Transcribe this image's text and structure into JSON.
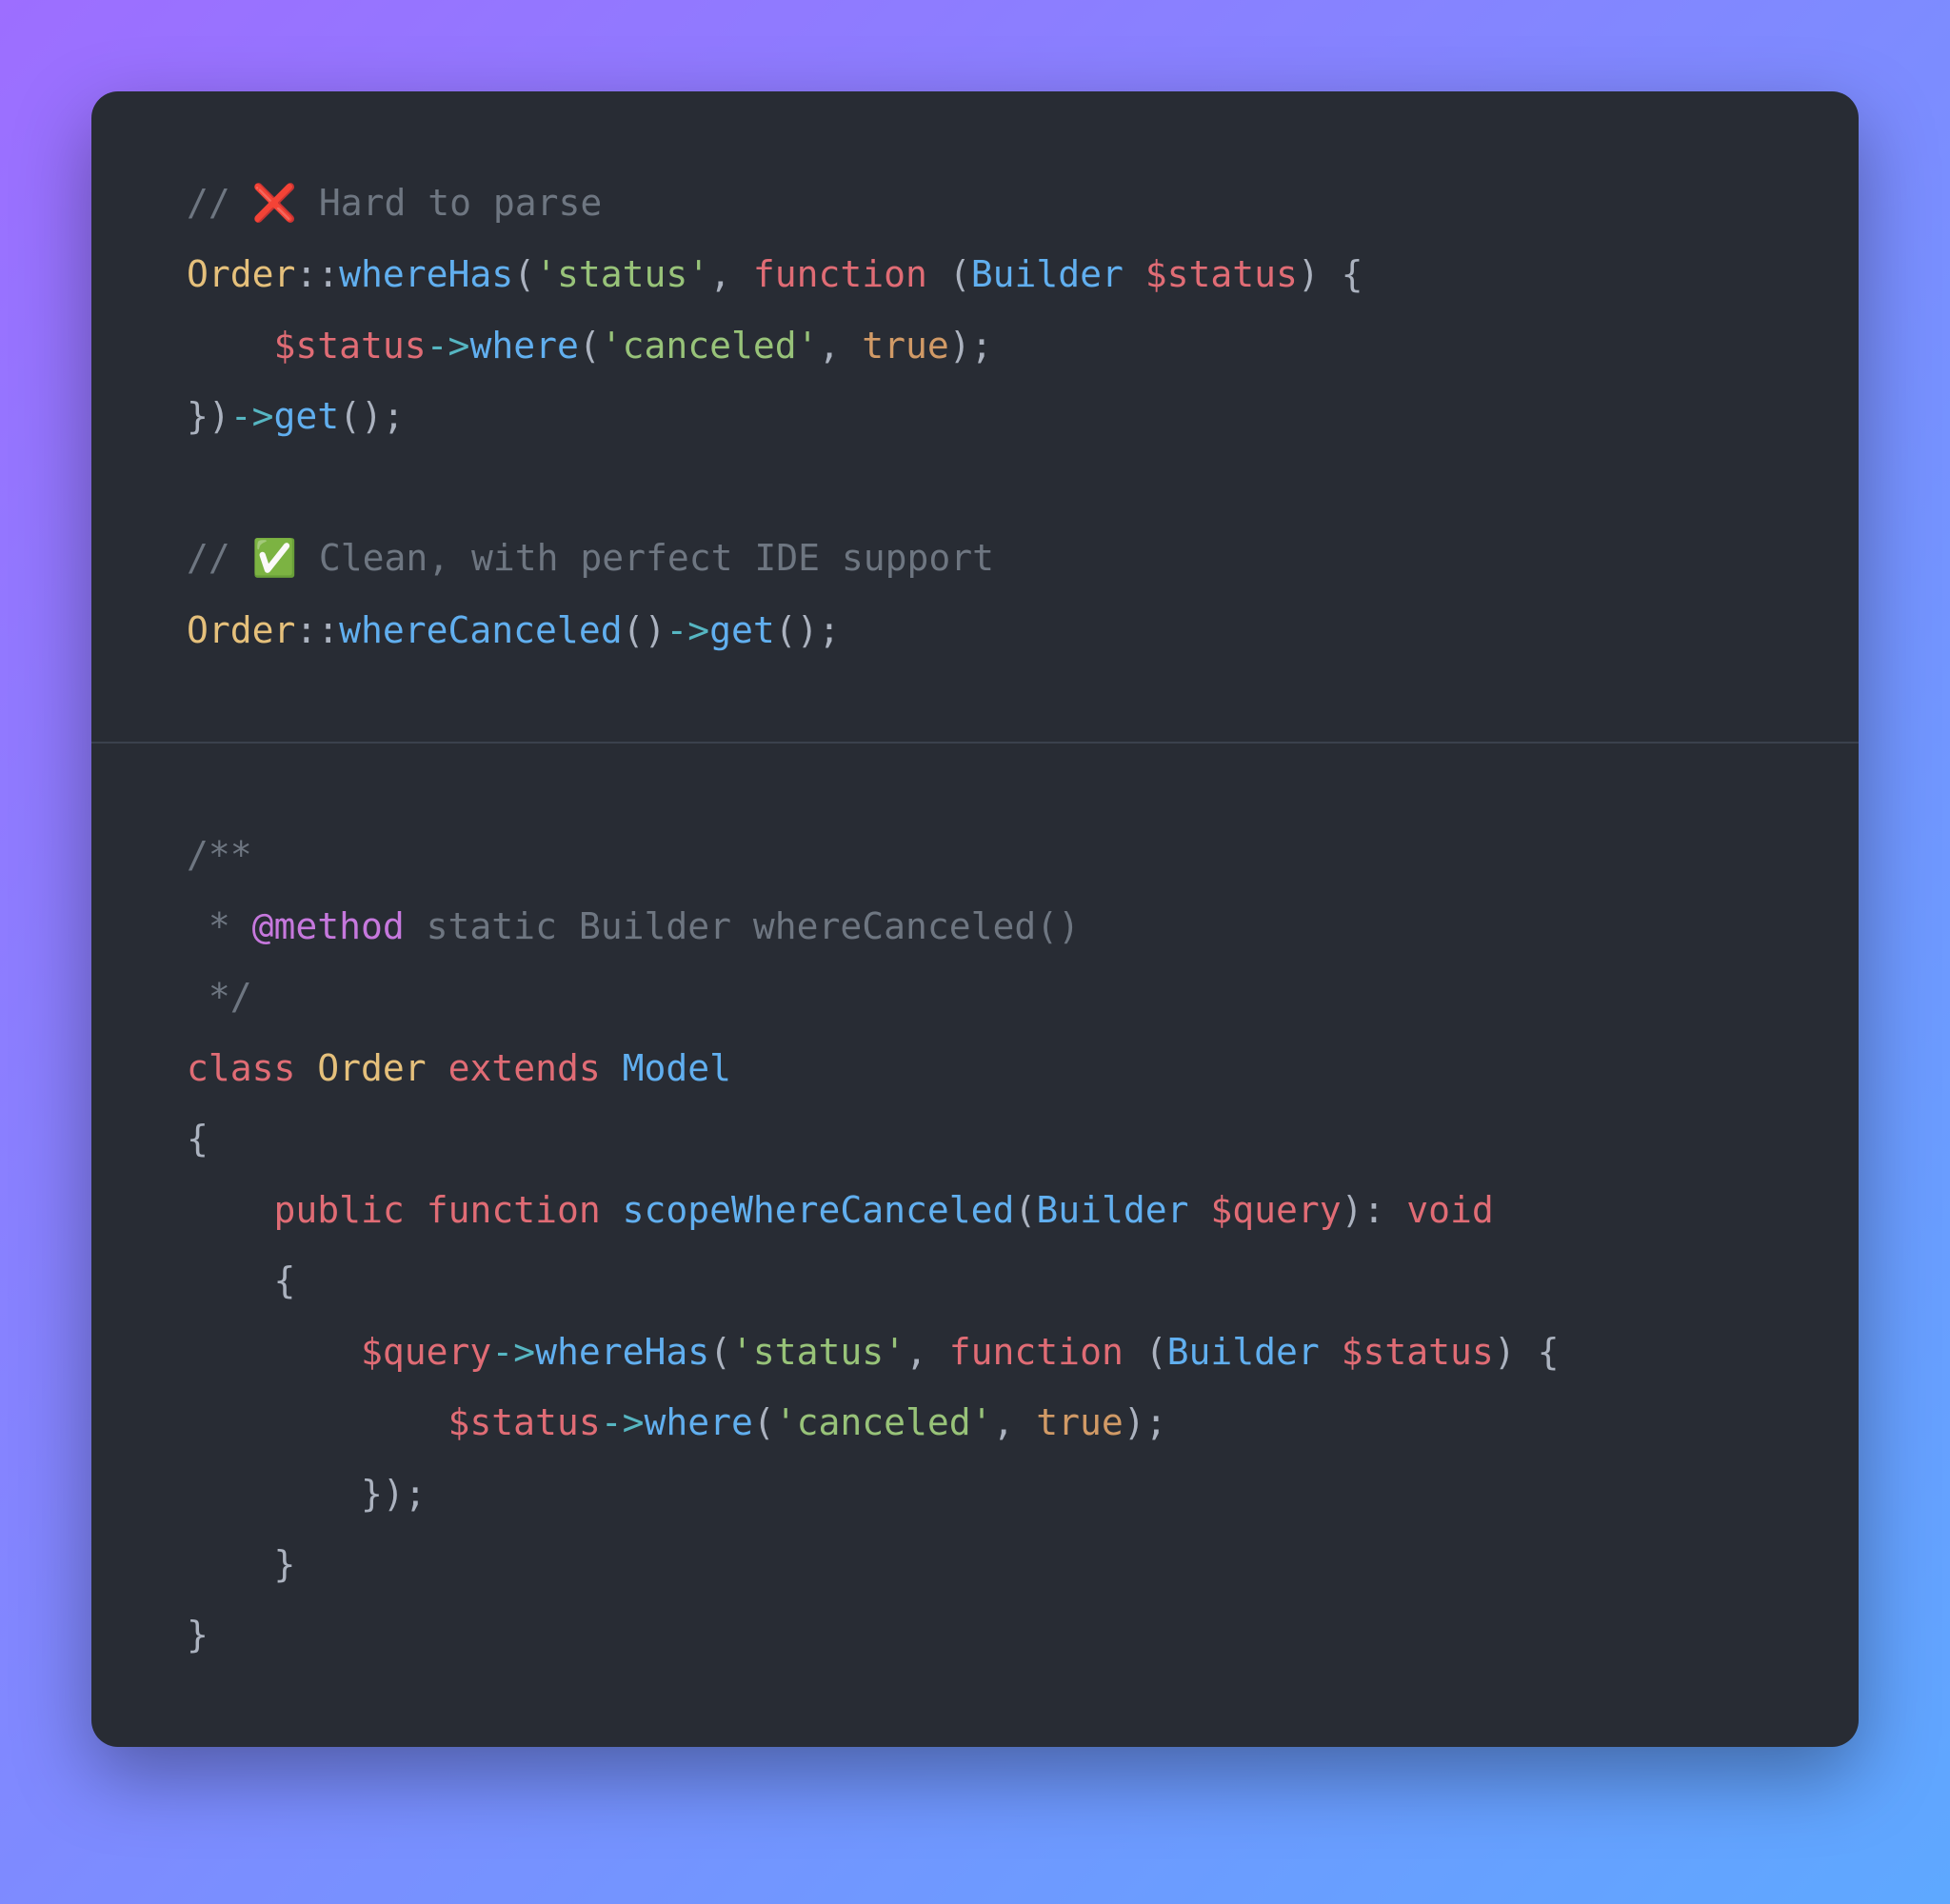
{
  "top": {
    "comment1_prefix": "// ",
    "comment1_emoji": "❌",
    "comment1_text": " Hard to parse",
    "l2_order": "Order",
    "l2_scope": "::",
    "l2_whereHas": "whereHas",
    "l2_paren1": "(",
    "l2_str_status": "'status'",
    "l2_comma": ", ",
    "l2_function": "function",
    "l2_space": " ",
    "l2_paren2": "(",
    "l2_builder": "Builder",
    "l2_space2": " ",
    "l2_var_status": "$status",
    "l2_paren3": ") {",
    "l3_indent": "    ",
    "l3_var_status": "$status",
    "l3_arrow": "->",
    "l3_where": "where",
    "l3_p1": "(",
    "l3_str": "'canceled'",
    "l3_comma": ", ",
    "l3_true": "true",
    "l3_p2": ");",
    "l4_close": "})",
    "l4_arrow": "->",
    "l4_get": "get",
    "l4_end": "();",
    "comment2_prefix": "// ",
    "comment2_emoji": "✅",
    "comment2_text": " Clean, with perfect IDE support",
    "l6_order": "Order",
    "l6_scope": "::",
    "l6_where": "whereCanceled",
    "l6_p1": "()",
    "l6_arrow": "->",
    "l6_get": "get",
    "l6_end": "();"
  },
  "bottom": {
    "d1": "/**",
    "d2_star": " * ",
    "d2_tag": "@method",
    "d2_rest": " static Builder whereCanceled()",
    "d3": " */",
    "c1_class": "class",
    "c1_sp1": " ",
    "c1_Order": "Order",
    "c1_sp2": " ",
    "c1_extends": "extends",
    "c1_sp3": " ",
    "c1_Model": "Model",
    "c2": "{",
    "m1_indent": "    ",
    "m1_public": "public",
    "m1_sp1": " ",
    "m1_function": "function",
    "m1_sp2": " ",
    "m1_name": "scopeWhereCanceled",
    "m1_p1": "(",
    "m1_Builder": "Builder",
    "m1_sp3": " ",
    "m1_query": "$query",
    "m1_p2": "): ",
    "m1_void": "void",
    "m2": "    {",
    "b1_indent": "        ",
    "b1_query": "$query",
    "b1_arrow": "->",
    "b1_whereHas": "whereHas",
    "b1_p1": "(",
    "b1_str": "'status'",
    "b1_comma": ", ",
    "b1_function": "function",
    "b1_sp": " ",
    "b1_p2": "(",
    "b1_Builder": "Builder",
    "b1_sp2": " ",
    "b1_status": "$status",
    "b1_p3": ") {",
    "b2_indent": "            ",
    "b2_status": "$status",
    "b2_arrow": "->",
    "b2_where": "where",
    "b2_p1": "(",
    "b2_str": "'canceled'",
    "b2_comma": ", ",
    "b2_true": "true",
    "b2_p2": ");",
    "b3": "        });",
    "m3": "    }",
    "c3": "}"
  }
}
